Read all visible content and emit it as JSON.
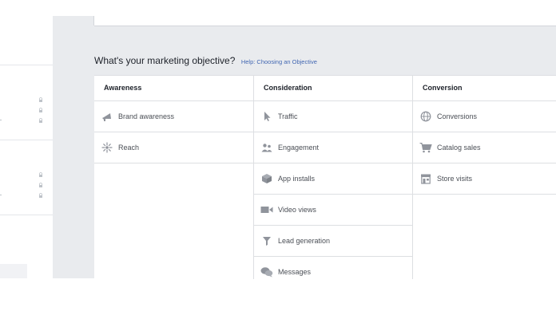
{
  "objective": {
    "question": "What's your marketing objective?",
    "help_link": "Help: Choosing an Objective"
  },
  "columns": [
    {
      "header": "Awareness",
      "items": [
        {
          "label": "Brand awareness",
          "icon": "megaphone-icon"
        },
        {
          "label": "Reach",
          "icon": "reach-icon"
        }
      ]
    },
    {
      "header": "Consideration",
      "items": [
        {
          "label": "Traffic",
          "icon": "cursor-icon"
        },
        {
          "label": "Engagement",
          "icon": "people-icon"
        },
        {
          "label": "App installs",
          "icon": "box-icon"
        },
        {
          "label": "Video views",
          "icon": "video-icon"
        },
        {
          "label": "Lead generation",
          "icon": "funnel-icon"
        },
        {
          "label": "Messages",
          "icon": "chat-icon"
        }
      ]
    },
    {
      "header": "Conversion",
      "items": [
        {
          "label": "Conversions",
          "icon": "globe-icon"
        },
        {
          "label": "Catalog sales",
          "icon": "cart-icon"
        },
        {
          "label": "Store visits",
          "icon": "store-icon"
        }
      ]
    }
  ],
  "colors": {
    "icon_gray": "#90949c",
    "link_blue": "#4267b2",
    "background_gray": "#e9ebee",
    "border": "#dddfe2"
  }
}
